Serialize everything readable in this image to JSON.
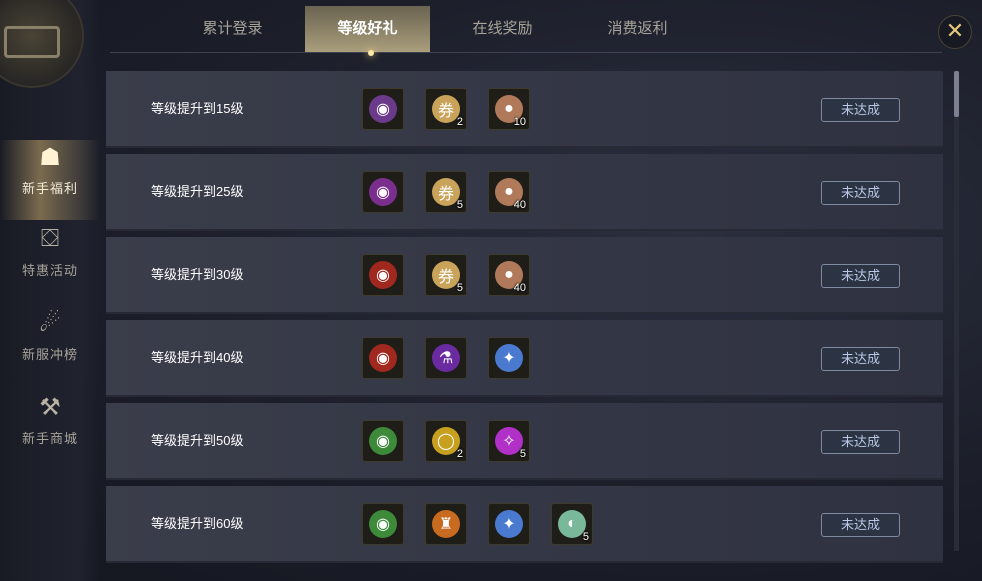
{
  "close_symbol": "✕",
  "sidebar": {
    "items": [
      {
        "label": "新手福利",
        "icon": "bag-icon",
        "glyph": "☗",
        "active": true
      },
      {
        "label": "特惠活动",
        "icon": "chest-icon",
        "glyph": "⛋",
        "active": false
      },
      {
        "label": "新服冲榜",
        "icon": "money-bag-icon",
        "glyph": "☄",
        "active": false
      },
      {
        "label": "新手商城",
        "icon": "shop-icon",
        "glyph": "⚒",
        "active": false
      }
    ]
  },
  "tabs": [
    {
      "label": "累计登录",
      "active": false
    },
    {
      "label": "等级好礼",
      "active": true
    },
    {
      "label": "在线奖励",
      "active": false
    },
    {
      "label": "消费返利",
      "active": false
    }
  ],
  "rows": [
    {
      "title": "等级提升到15级",
      "button": "未达成",
      "rewards": [
        {
          "icon": "purple-pouch-icon",
          "color": "#6b3a8a",
          "glyph": "◉",
          "count": ""
        },
        {
          "icon": "scroll-icon",
          "color": "#c9a35a",
          "glyph": "券",
          "count": "2"
        },
        {
          "icon": "orb-icon",
          "color": "#b07a5a",
          "glyph": "●",
          "count": "10"
        }
      ]
    },
    {
      "title": "等级提升到25级",
      "button": "未达成",
      "rewards": [
        {
          "icon": "purple-pouch-icon",
          "color": "#7a2f8f",
          "glyph": "◉",
          "count": ""
        },
        {
          "icon": "scroll-icon",
          "color": "#c9a35a",
          "glyph": "券",
          "count": "5"
        },
        {
          "icon": "orb-icon",
          "color": "#b07a5a",
          "glyph": "●",
          "count": "40"
        }
      ]
    },
    {
      "title": "等级提升到30级",
      "button": "未达成",
      "rewards": [
        {
          "icon": "red-pouch-icon",
          "color": "#a0281e",
          "glyph": "◉",
          "count": ""
        },
        {
          "icon": "scroll-icon",
          "color": "#c9a35a",
          "glyph": "券",
          "count": "5"
        },
        {
          "icon": "orb-icon",
          "color": "#b07a5a",
          "glyph": "●",
          "count": "40"
        }
      ]
    },
    {
      "title": "等级提升到40级",
      "button": "未达成",
      "rewards": [
        {
          "icon": "red-pouch-icon",
          "color": "#a0281e",
          "glyph": "◉",
          "count": ""
        },
        {
          "icon": "potion-icon",
          "color": "#6a2aa0",
          "glyph": "⚗",
          "count": ""
        },
        {
          "icon": "blue-orb-icon",
          "color": "#4a7ad0",
          "glyph": "✦",
          "count": ""
        }
      ]
    },
    {
      "title": "等级提升到50级",
      "button": "未达成",
      "rewards": [
        {
          "icon": "green-pouch-icon",
          "color": "#3d8a3a",
          "glyph": "◉",
          "count": ""
        },
        {
          "icon": "bracelet-icon",
          "color": "#c8a020",
          "glyph": "◯",
          "count": "2"
        },
        {
          "icon": "magic-swirl-icon",
          "color": "#b030c8",
          "glyph": "✧",
          "count": "5"
        }
      ]
    },
    {
      "title": "等级提升到60级",
      "button": "未达成",
      "rewards": [
        {
          "icon": "green-pouch-icon",
          "color": "#3d8a3a",
          "glyph": "◉",
          "count": ""
        },
        {
          "icon": "armor-icon",
          "color": "#c86a20",
          "glyph": "♜",
          "count": ""
        },
        {
          "icon": "blue-orb-icon",
          "color": "#4a7ad0",
          "glyph": "✦",
          "count": ""
        },
        {
          "icon": "jade-icon",
          "color": "#7ab89a",
          "glyph": "◐",
          "count": "5"
        }
      ]
    }
  ]
}
